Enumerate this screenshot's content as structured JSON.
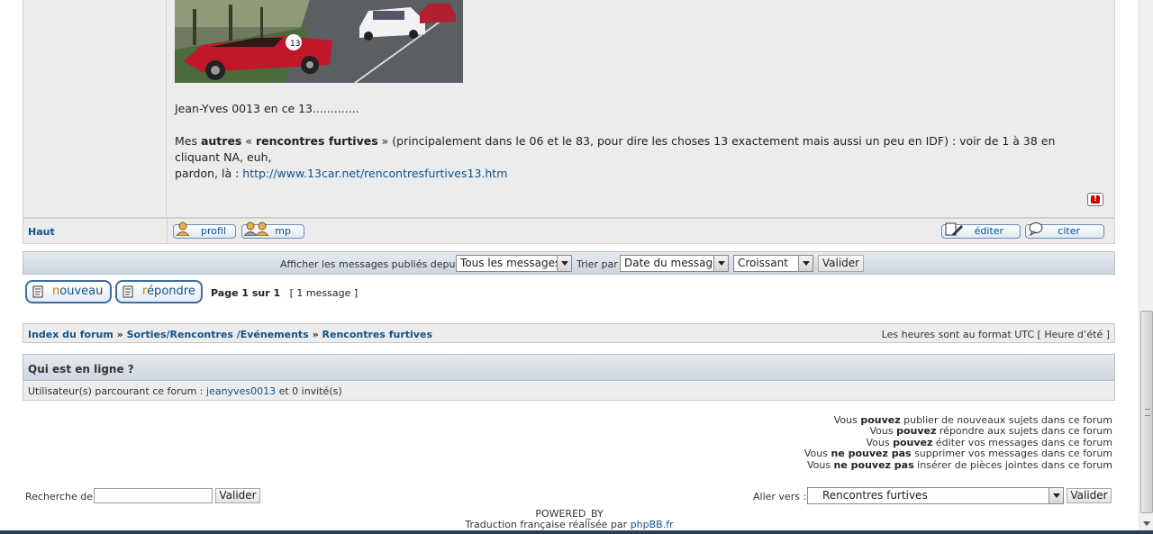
{
  "post": {
    "line1": "Jean-Yves 0013 en ce 13.............",
    "line2_pre": "Mes ",
    "line2_b1": "autres",
    "line2_mid": " « ",
    "line2_b2": "rencontres furtives",
    "line2_post": " » (principalement dans le 06 et le 83, pour dire les choses 13 exactement mais aussi un peu en IDF) : voir de 1 à 38 en cliquant NA, euh,",
    "line3_pre": "pardon, là : ",
    "link": "http://www.13car.net/rencontresfurtives13.htm",
    "report_glyph": "!"
  },
  "post_footer": {
    "haut": "Haut",
    "profil": "profil",
    "mp": "mp",
    "editer": "éditer",
    "citer": "citer"
  },
  "filter": {
    "label_since": "Afficher les messages publiés depuis :",
    "since_value": "Tous les messages",
    "label_sort": "Trier par",
    "sort_value": "Date du message",
    "order_value": "Croissant",
    "submit": "Valider"
  },
  "actions": {
    "new_first": "n",
    "new_rest": "ouveau",
    "reply_first": "r",
    "reply_rest": "épondre",
    "page": "Page 1 sur 1",
    "count": "[ 1 message ]"
  },
  "breadcrumb": {
    "index": "Index du forum",
    "sep": "»",
    "category": "Sorties/Rencontres /Evénements",
    "forum": "Rencontres furtives",
    "timezone": "Les heures sont au format UTC [ Heure d’été ]"
  },
  "online": {
    "title": "Qui est en ligne ?",
    "prefix": "Utilisateur(s) parcourant ce forum : ",
    "user": "jeanyves0013",
    "suffix": " et 0 invité(s)"
  },
  "permissions": [
    {
      "pre": "Vous ",
      "b": "pouvez",
      "post": " publier de nouveaux sujets dans ce forum"
    },
    {
      "pre": "Vous ",
      "b": "pouvez",
      "post": " répondre aux sujets dans ce forum"
    },
    {
      "pre": "Vous ",
      "b": "pouvez",
      "post": " éditer vos messages dans ce forum"
    },
    {
      "pre": "Vous ",
      "b": "ne pouvez pas",
      "post": " supprimer vos messages dans ce forum"
    },
    {
      "pre": "Vous ",
      "b": "ne pouvez pas",
      "post": " insérer de pièces jointes dans ce forum"
    }
  ],
  "search": {
    "label": "Recherche de:",
    "value": "",
    "submit": "Valider"
  },
  "jump": {
    "label": "Aller vers :",
    "value": "Rencontres furtives",
    "submit": "Valider"
  },
  "footer": {
    "powered": "POWERED_BY",
    "translation_pre": "Traduction française réalisée par ",
    "translation_link": "phpBB.fr"
  },
  "colors": {
    "link": "#105289",
    "accent_orange": "#e07000",
    "bar_gradient_top": "#e6ebf0",
    "bar_gradient_bottom": "#cdd5de"
  }
}
